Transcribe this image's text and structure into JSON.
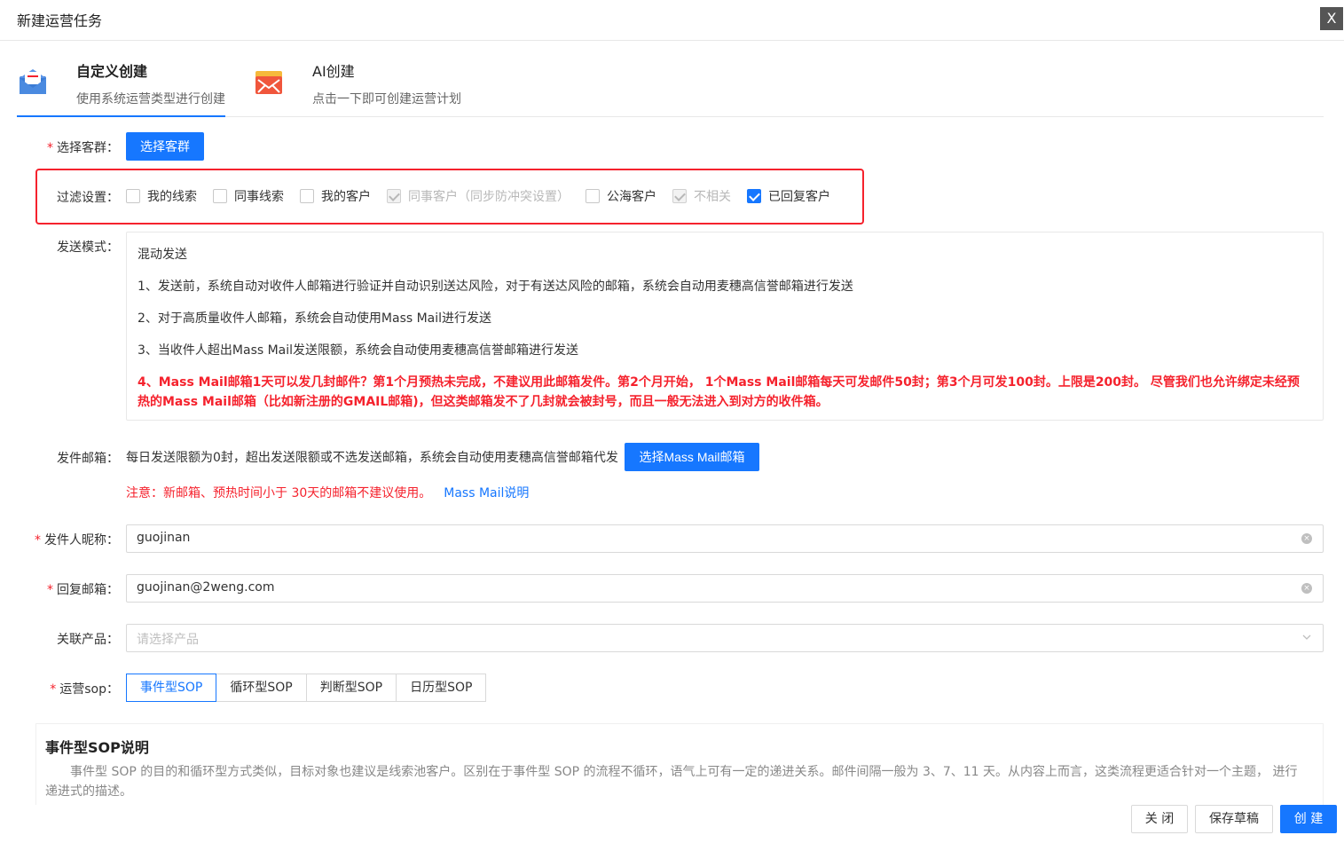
{
  "header": {
    "title": "新建运营任务",
    "close_label": "X"
  },
  "mode_tabs": [
    {
      "title": "自定义创建",
      "subtitle": "使用系统运营类型进行创建",
      "icon": "envelope-open-icon"
    },
    {
      "title": "AI创建",
      "subtitle": "点击一下即可创建运营计划",
      "icon": "mail-box-icon"
    }
  ],
  "customer_group": {
    "label": "选择客群：",
    "button": "选择客群"
  },
  "filter": {
    "label": "过滤设置：",
    "options": [
      {
        "label": "我的线索",
        "state": "unchecked"
      },
      {
        "label": "同事线索",
        "state": "unchecked"
      },
      {
        "label": "我的客户",
        "state": "unchecked"
      },
      {
        "label": "同事客户（同步防冲突设置）",
        "state": "checked-disabled"
      },
      {
        "label": "公海客户",
        "state": "unchecked"
      },
      {
        "label": "不相关",
        "state": "checked-disabled"
      },
      {
        "label": "已回复客户",
        "state": "checked"
      }
    ]
  },
  "send_mode": {
    "label": "发送模式：",
    "title": "混动发送",
    "lines": [
      "1、发送前，系统自动对收件人邮箱进行验证并自动识别送达风险，对于有送达风险的邮箱，系统会自动用麦穗高信誉邮箱进行发送",
      "2、对于高质量收件人邮箱，系统会自动使用Mass Mail进行发送",
      "3、当收件人超出Mass Mail发送限额，系统会自动使用麦穗高信誉邮箱进行发送"
    ],
    "warning": "4、Mass Mail邮箱1天可以发几封邮件？第1个月预热未完成，不建议用此邮箱发件。第2个月开始， 1个Mass Mail邮箱每天可发邮件50封；第3个月可发100封。上限是200封。 尽管我们也允许绑定未经预热的Mass Mail邮箱（比如新注册的GMAIL邮箱)，但这类邮箱发不了几封就会被封号，而且一般无法进入到对方的收件箱。"
  },
  "sender_mailbox": {
    "label": "发件邮箱：",
    "text": "每日发送限额为0封，超出发送限额或不选发送邮箱，系统会自动使用麦穗高信誉邮箱代发",
    "button": "选择Mass Mail邮箱",
    "notice": "注意：新邮箱、预热时间小于 30天的邮箱不建议使用。",
    "link": "Mass Mail说明"
  },
  "sender_name": {
    "label": "发件人昵称：",
    "value": "guojinan"
  },
  "reply_email": {
    "label": "回复邮箱：",
    "value": "guojinan@2weng.com"
  },
  "product": {
    "label": "关联产品：",
    "placeholder": "请选择产品"
  },
  "sop": {
    "label": "运营sop：",
    "options": [
      "事件型SOP",
      "循环型SOP",
      "判断型SOP",
      "日历型SOP"
    ],
    "active": "事件型SOP"
  },
  "sop_desc": {
    "title": "事件型SOP说明",
    "text": "事件型 SOP 的目的和循环型方式类似，目标对象也建议是线索池客户。区别在于事件型 SOP 的流程不循环，语气上可有一定的递进关系。邮件间隔一般为 3、7、11 天。从内容上而言，这类流程更适合针对一个主题， 进行递进式的描述。"
  },
  "footer": {
    "close": "关 闭",
    "save_draft": "保存草稿",
    "create": "创 建"
  },
  "colors": {
    "primary": "#1677ff",
    "danger": "#f5222d"
  }
}
